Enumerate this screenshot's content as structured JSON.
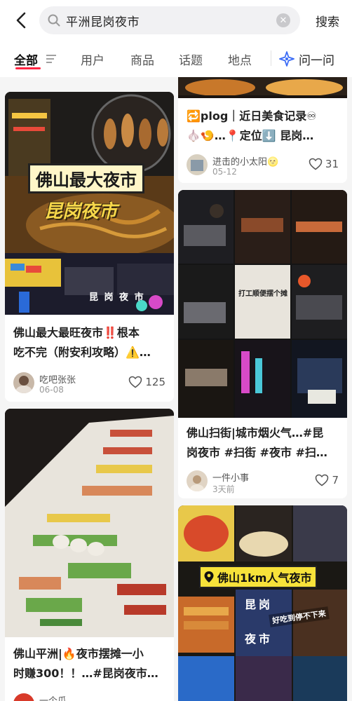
{
  "search": {
    "query": "平洲昆岗夜市",
    "button_label": "搜索"
  },
  "tabs": {
    "items": [
      {
        "label": "全部"
      },
      {
        "label": "用户"
      },
      {
        "label": "商品"
      },
      {
        "label": "话题"
      },
      {
        "label": "地点"
      },
      {
        "label": "问一问"
      }
    ]
  },
  "colors": {
    "accent": "#ff2442",
    "ask": "#3b6cf6"
  },
  "cards": [
    {
      "title_line1": "佛山最大最旺夜市‼️根本",
      "title_line2": "吃不完（附安利攻略）⚠️…",
      "author": "吃吧张张",
      "date": "06-08",
      "likes": "125",
      "overlay1": "佛山最大夜市",
      "overlay2": "昆岗夜市",
      "sign": "昆 岗 夜 市"
    },
    {
      "title_line1": "佛山平洲|🔥夜市摆摊一小",
      "title_line2": "时赚300！！…#昆岗夜市…",
      "author": "一个瓜"
    },
    {
      "title_line1": "🔁plog｜近日美食记录♾",
      "title_line2": "🧄🍤…📍定位⬇️ 昆岗…",
      "author": "进击的小太阳🌝",
      "date": "05-12",
      "likes": "31"
    },
    {
      "title_line1": "佛山扫街|城市烟火气…#昆",
      "title_line2": "岗夜市 #扫街 #夜市 #扫…",
      "author": "一件小事",
      "date": "3天前",
      "likes": "7",
      "sign": "打工顺便摆个摊"
    },
    {
      "overlay1": "佛山1km人气夜市",
      "sign1": "昆岗",
      "sign2": "夜市",
      "overlay2": "好吃到停不下来"
    }
  ],
  "icons": [
    "back-arrow-icon",
    "search-icon",
    "clear-icon",
    "filter-icon",
    "ask-sparkle-icon",
    "heart-icon",
    "location-pin-icon"
  ]
}
